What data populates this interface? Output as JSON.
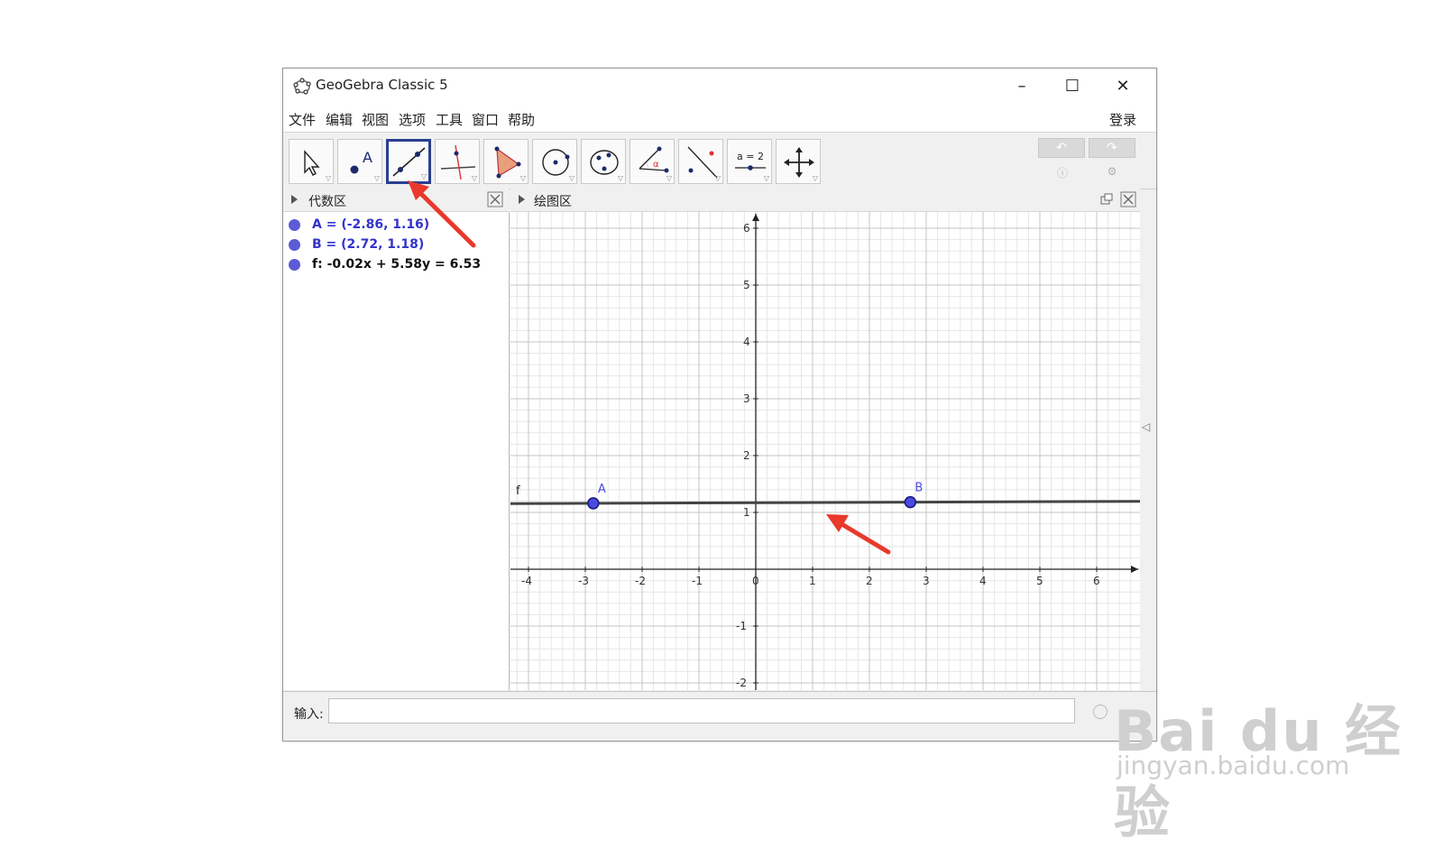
{
  "window": {
    "title": "GeoGebra Classic 5",
    "controls": {
      "minimize": "–",
      "maximize": "☐",
      "close": "✕"
    }
  },
  "menu": {
    "items": [
      "文件",
      "编辑",
      "视图",
      "选项",
      "工具",
      "窗口",
      "帮助"
    ],
    "login": "登录"
  },
  "toolbar": {
    "tools": [
      {
        "icon": "move-arrow-icon"
      },
      {
        "icon": "point-icon",
        "label": "A"
      },
      {
        "icon": "line-icon",
        "selected": true
      },
      {
        "icon": "perpendicular-line-icon"
      },
      {
        "icon": "polygon-icon"
      },
      {
        "icon": "circle-icon"
      },
      {
        "icon": "conic-icon"
      },
      {
        "icon": "angle-icon",
        "label": "α"
      },
      {
        "icon": "reflect-icon"
      },
      {
        "icon": "slider-icon",
        "label": "a = 2"
      },
      {
        "icon": "move-graphics-icon"
      }
    ],
    "undo_icon": "undo-icon",
    "redo_icon": "redo-icon",
    "help_icon": "help-icon",
    "settings_icon": "gear-icon"
  },
  "algebra": {
    "title": "代数区",
    "items": [
      {
        "text": "A = (-2.86, 1.16)",
        "color": "#3333cc"
      },
      {
        "text": "B = (2.72, 1.18)",
        "color": "#3333cc"
      },
      {
        "text": "f: -0.02x + 5.58y = 6.53",
        "color": "#111111"
      }
    ]
  },
  "graphics": {
    "title": "绘图区",
    "x_ticks": [
      "-4",
      "-3",
      "-2",
      "-1",
      "0",
      "1",
      "2",
      "3",
      "4",
      "5",
      "6"
    ],
    "y_ticks": [
      "6",
      "5",
      "4",
      "3",
      "2",
      "1",
      "-1",
      "-2"
    ],
    "points": [
      {
        "label": "A",
        "x": -2.86,
        "y": 1.16
      },
      {
        "label": "B",
        "x": 2.72,
        "y": 1.18
      }
    ],
    "line_label": "f"
  },
  "input": {
    "label": "输入:"
  },
  "watermark": {
    "brand": "Bai  du 经验",
    "url": "jingyan.baidu.com"
  }
}
